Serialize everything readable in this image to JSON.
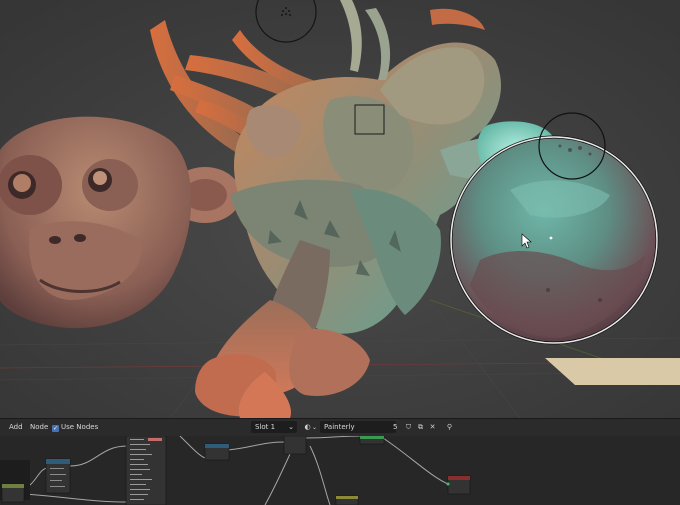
{
  "node_editor": {
    "menu": {
      "add": "Add",
      "node": "Node"
    },
    "use_nodes_label": "Use Nodes",
    "use_nodes_checked": true,
    "slot": "Slot 1",
    "material_name": "Painterly",
    "user_count": "5",
    "icons": {
      "checkbox": "checkmark-icon",
      "slot_dropdown": "chevron-down-icon",
      "material_browse": "material-sphere-icon",
      "fake_user": "shield-icon",
      "duplicate": "duplicate-icon",
      "unlink": "close-icon",
      "pin": "pin-icon"
    }
  },
  "colors": {
    "header_bg": "#2b2b2b",
    "node_canvas_bg": "#272727",
    "accent": "#4772b3",
    "viewport_bg": "#3f3f3f"
  }
}
